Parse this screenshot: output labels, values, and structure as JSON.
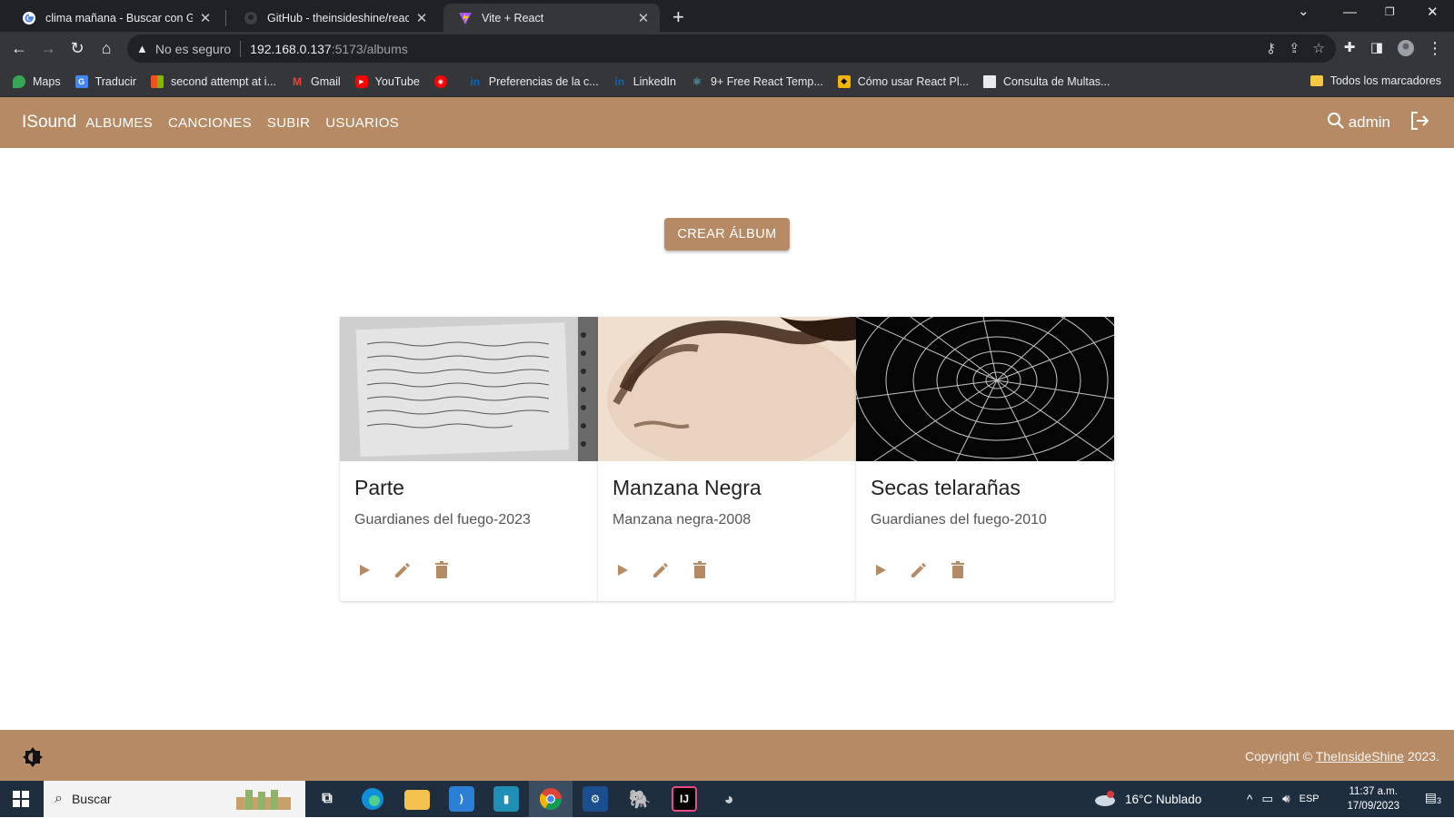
{
  "browser": {
    "tabs": [
      {
        "title": "clima mañana - Buscar con Goog",
        "icon": "google-icon"
      },
      {
        "title": "GitHub - theinsideshine/react-ins",
        "icon": "github-icon"
      },
      {
        "title": "Vite + React",
        "icon": "vite-icon",
        "active": true
      }
    ],
    "security_label": "No es seguro",
    "url_host": "192.168.0.137",
    "url_path": ":5173/albums",
    "bookmarks": [
      {
        "label": "Maps",
        "icon": "maps-icon",
        "color": "#34a853"
      },
      {
        "label": "Traducir",
        "icon": "translate-icon",
        "color": "#4285f4"
      },
      {
        "label": "second attempt at i...",
        "icon": "microsoft-icon",
        "color": "#f25022"
      },
      {
        "label": "Gmail",
        "icon": "gmail-icon",
        "color": "#ea4335"
      },
      {
        "label": "YouTube",
        "icon": "youtube-icon",
        "color": "#ff0000"
      },
      {
        "label": "",
        "icon": "youtube-music-icon",
        "color": "#ff0000"
      },
      {
        "label": "Preferencias de la c...",
        "icon": "linkedin-icon",
        "color": "#0a66c2"
      },
      {
        "label": "LinkedIn",
        "icon": "linkedin-icon",
        "color": "#0a66c2"
      },
      {
        "label": "9+ Free React Temp...",
        "icon": "react-icon",
        "color": "#61dafb"
      },
      {
        "label": "Cómo usar React Pl...",
        "icon": "cat-icon",
        "color": "#f4b400"
      },
      {
        "label": "Consulta de Multas...",
        "icon": "doc-icon",
        "color": "#e8eaed"
      }
    ],
    "all_bookmarks": "Todos los marcadores"
  },
  "app": {
    "brand": "ISound",
    "nav": [
      "ALBUMES",
      "CANCIONES",
      "SUBIR",
      "USUARIOS"
    ],
    "user": "admin",
    "create_button": "CREAR ÁLBUM",
    "albums": [
      {
        "name": "Parte",
        "subtitle": "Guardianes del fuego-2023",
        "image": "handwritten-notebook"
      },
      {
        "name": "Manzana Negra",
        "subtitle": "Manzana negra-2008",
        "image": "dark-hair-sepia"
      },
      {
        "name": "Secas telarañas",
        "subtitle": "Guardianes del fuego-2010",
        "image": "spider-web"
      }
    ],
    "footer": {
      "copyright_prefix": "Copyright © ",
      "copyright_link": "TheInsideShine",
      "copyright_year": " 2023."
    },
    "accent_color": "#b58a64"
  },
  "taskbar": {
    "search_placeholder": "Buscar",
    "weather": "16°C  Nublado",
    "language": "ESP",
    "time": "11:37 a.m.",
    "date": "17/09/2023",
    "notification_count": "3"
  }
}
